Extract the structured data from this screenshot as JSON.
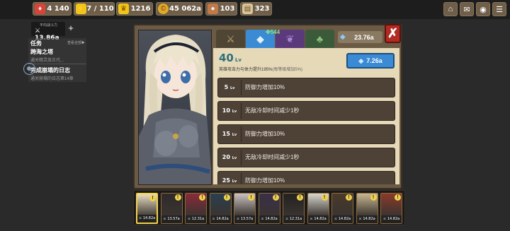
{
  "top_bar": {
    "resources": [
      {
        "icon": "ruby-icon",
        "value": "4 140",
        "color": "#d9433a"
      },
      {
        "icon": "energy-icon",
        "value": "7 / 110",
        "color": "#f0c419"
      },
      {
        "icon": "trophy-icon",
        "value": "1216",
        "color": "#f0c419"
      },
      {
        "icon": "gold-coin-icon",
        "value": "45 062a",
        "color": "#e0a92a"
      },
      {
        "icon": "meat-icon",
        "value": "103",
        "color": "#c07a4a"
      },
      {
        "icon": "scroll-icon",
        "value": "323",
        "color": "#d8c49a"
      }
    ],
    "buttons": [
      "home-icon",
      "mail-icon",
      "camera-icon",
      "menu-icon"
    ]
  },
  "left_panel": {
    "power_label": "平均战斗力",
    "power_value": "13.86a",
    "quest_header": "任务",
    "quest_view_all": "查看全部▶",
    "quests": [
      {
        "title": "跨海之塔",
        "subtitle": "通关精灵族古代..."
      },
      {
        "title": "完成崩塌的日志",
        "subtitle": "通关崩塌的日志第14章"
      }
    ]
  },
  "main": {
    "tabs": [
      {
        "icon": "weapon-icon",
        "color": "#4a6b3a"
      },
      {
        "icon": "gem-icon",
        "color": "#3a8ad4",
        "active": true
      },
      {
        "icon": "wing-icon",
        "color": "#5a3a7a"
      },
      {
        "icon": "bag-icon",
        "color": "#3a5a3a"
      }
    ],
    "level_badge": "544",
    "gem_counter": "23.76a",
    "level": "40",
    "level_unit": "Lv",
    "bonus_desc": "英雄攻击力与体力提升195%",
    "bonus_note": "(每等级增加5%)",
    "upgrade_cost": "7.26a",
    "rows": [
      {
        "level": "5",
        "unit": "Lv",
        "text": "防御力增加10%"
      },
      {
        "level": "10",
        "unit": "Lv",
        "text": "无敌冷却时间减少1秒"
      },
      {
        "level": "15",
        "unit": "Lv",
        "text": "防御力增加10%"
      },
      {
        "level": "20",
        "unit": "Lv",
        "text": "无敌冷却时间减少1秒"
      },
      {
        "level": "25",
        "unit": "Lv",
        "text": "防御力增加10%"
      }
    ]
  },
  "roster": [
    {
      "power": "14.82a",
      "color": "#e8dcc0",
      "selected": true,
      "alert": true
    },
    {
      "power": "13.57a",
      "color": "#2f2a2a",
      "alert": true
    },
    {
      "power": "12.31a",
      "color": "#8a2a3a",
      "alert": true
    },
    {
      "power": "14.82a",
      "color": "#2a3f4f",
      "alert": true
    },
    {
      "power": "13.57a",
      "color": "#c9c2c2",
      "alert": true
    },
    {
      "power": "14.82a",
      "color": "#3a2f4a",
      "alert": true
    },
    {
      "power": "12.31a",
      "color": "#222222",
      "alert": true
    },
    {
      "power": "14.82a",
      "color": "#d8d8d0",
      "alert": true
    },
    {
      "power": "14.82a",
      "color": "#4a3a2a",
      "alert": true
    },
    {
      "power": "14.82a",
      "color": "#c8b890",
      "alert": true
    },
    {
      "power": "14.82a",
      "color": "#8a3a2a",
      "alert": true
    }
  ]
}
